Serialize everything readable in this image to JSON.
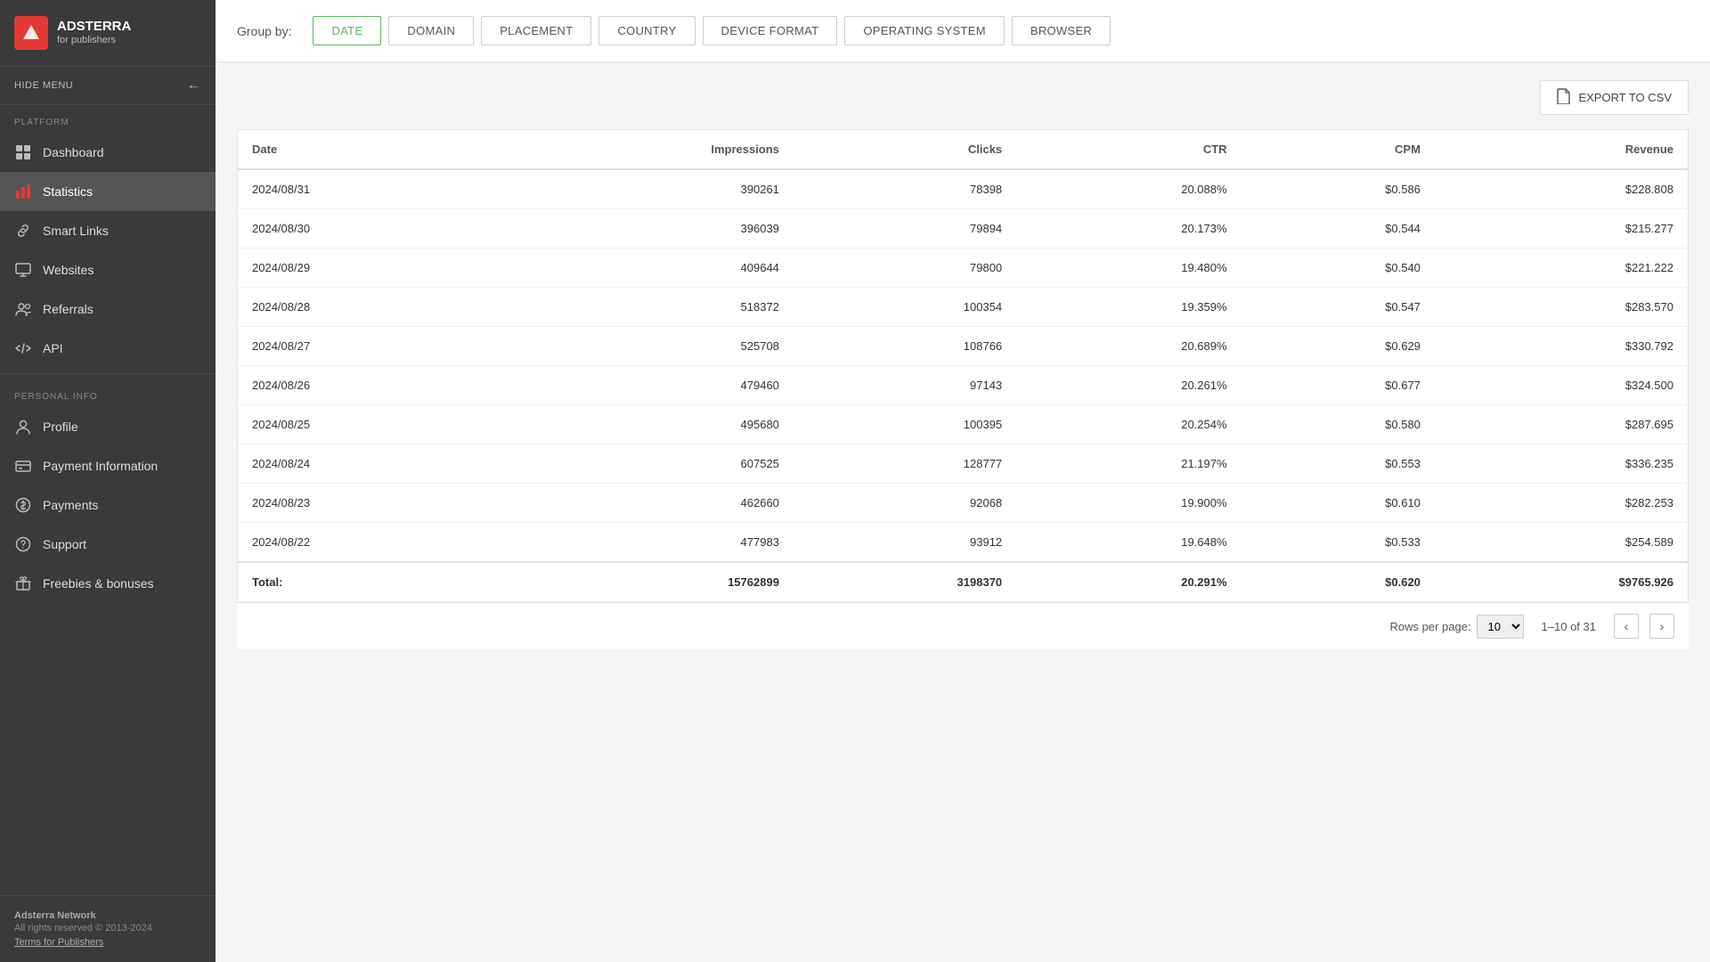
{
  "app": {
    "brand": "ADSTERRA",
    "sub": "for publishers",
    "logo_letter": "A"
  },
  "sidebar": {
    "hide_menu": "HIDE MENU",
    "sections": [
      {
        "label": "PLATFORM",
        "items": [
          {
            "id": "dashboard",
            "label": "Dashboard",
            "icon": "grid"
          },
          {
            "id": "statistics",
            "label": "Statistics",
            "icon": "bar-chart",
            "active": true
          },
          {
            "id": "smart-links",
            "label": "Smart Links",
            "icon": "link"
          },
          {
            "id": "websites",
            "label": "Websites",
            "icon": "monitor"
          },
          {
            "id": "referrals",
            "label": "Referrals",
            "icon": "users"
          },
          {
            "id": "api",
            "label": "API",
            "icon": "code"
          }
        ]
      },
      {
        "label": "PERSONAL INFO",
        "items": [
          {
            "id": "profile",
            "label": "Profile",
            "icon": "person"
          },
          {
            "id": "payment-info",
            "label": "Payment Information",
            "icon": "card"
          },
          {
            "id": "payments",
            "label": "Payments",
            "icon": "dollar"
          },
          {
            "id": "support",
            "label": "Support",
            "icon": "help"
          },
          {
            "id": "freebies",
            "label": "Freebies & bonuses",
            "icon": "gift"
          }
        ]
      }
    ],
    "footer": {
      "company": "Adsterra Network",
      "rights": "All rights reserved © 2013-2024",
      "terms_link": "Terms for Publishers"
    }
  },
  "group_by": {
    "label": "Group by:",
    "buttons": [
      {
        "id": "date",
        "label": "DATE",
        "active": true
      },
      {
        "id": "domain",
        "label": "DOMAIN",
        "active": false
      },
      {
        "id": "placement",
        "label": "PLACEMENT",
        "active": false
      },
      {
        "id": "country",
        "label": "COUNTRY",
        "active": false
      },
      {
        "id": "device-format",
        "label": "DEVICE FORMAT",
        "active": false
      },
      {
        "id": "operating-system",
        "label": "OPERATING SYSTEM",
        "active": false
      },
      {
        "id": "browser",
        "label": "BROWSER",
        "active": false
      }
    ]
  },
  "table": {
    "export_label": "EXPORT TO CSV",
    "columns": [
      {
        "id": "date",
        "label": "Date",
        "numeric": false
      },
      {
        "id": "impressions",
        "label": "Impressions",
        "numeric": true
      },
      {
        "id": "clicks",
        "label": "Clicks",
        "numeric": true
      },
      {
        "id": "ctr",
        "label": "CTR",
        "numeric": true
      },
      {
        "id": "cpm",
        "label": "CPM",
        "numeric": true
      },
      {
        "id": "revenue",
        "label": "Revenue",
        "numeric": true
      }
    ],
    "rows": [
      {
        "date": "2024/08/31",
        "impressions": "390261",
        "clicks": "78398",
        "ctr": "20.088%",
        "cpm": "$0.586",
        "revenue": "$228.808"
      },
      {
        "date": "2024/08/30",
        "impressions": "396039",
        "clicks": "79894",
        "ctr": "20.173%",
        "cpm": "$0.544",
        "revenue": "$215.277"
      },
      {
        "date": "2024/08/29",
        "impressions": "409644",
        "clicks": "79800",
        "ctr": "19.480%",
        "cpm": "$0.540",
        "revenue": "$221.222"
      },
      {
        "date": "2024/08/28",
        "impressions": "518372",
        "clicks": "100354",
        "ctr": "19.359%",
        "cpm": "$0.547",
        "revenue": "$283.570"
      },
      {
        "date": "2024/08/27",
        "impressions": "525708",
        "clicks": "108766",
        "ctr": "20.689%",
        "cpm": "$0.629",
        "revenue": "$330.792"
      },
      {
        "date": "2024/08/26",
        "impressions": "479460",
        "clicks": "97143",
        "ctr": "20.261%",
        "cpm": "$0.677",
        "revenue": "$324.500"
      },
      {
        "date": "2024/08/25",
        "impressions": "495680",
        "clicks": "100395",
        "ctr": "20.254%",
        "cpm": "$0.580",
        "revenue": "$287.695"
      },
      {
        "date": "2024/08/24",
        "impressions": "607525",
        "clicks": "128777",
        "ctr": "21.197%",
        "cpm": "$0.553",
        "revenue": "$336.235"
      },
      {
        "date": "2024/08/23",
        "impressions": "462660",
        "clicks": "92068",
        "ctr": "19.900%",
        "cpm": "$0.610",
        "revenue": "$282.253"
      },
      {
        "date": "2024/08/22",
        "impressions": "477983",
        "clicks": "93912",
        "ctr": "19.648%",
        "cpm": "$0.533",
        "revenue": "$254.589"
      }
    ],
    "total": {
      "label": "Total:",
      "impressions": "15762899",
      "clicks": "3198370",
      "ctr": "20.291%",
      "cpm": "$0.620",
      "revenue": "$9765.926"
    },
    "pagination": {
      "rows_per_page_label": "Rows per page:",
      "rows_per_page_value": "10",
      "page_info": "1–10 of 31"
    }
  }
}
